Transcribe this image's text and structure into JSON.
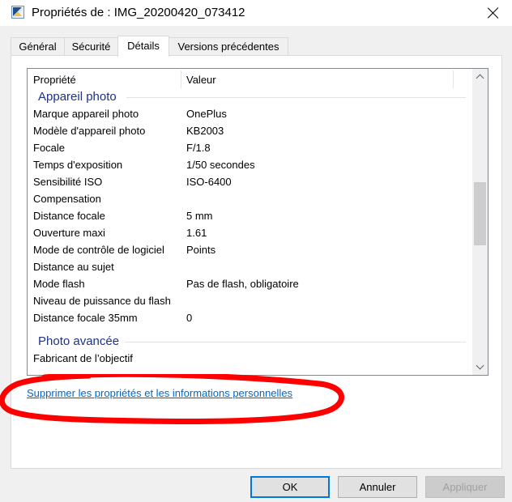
{
  "window": {
    "title": "Propriétés de : IMG_20200420_073412",
    "icon": "image-file-icon"
  },
  "tabs": [
    {
      "label": "Général",
      "active": false
    },
    {
      "label": "Sécurité",
      "active": false
    },
    {
      "label": "Détails",
      "active": true
    },
    {
      "label": "Versions précédentes",
      "active": false
    }
  ],
  "listview": {
    "headers": {
      "property": "Propriété",
      "value": "Valeur"
    },
    "groups": {
      "camera": "Appareil photo",
      "advanced": "Photo avancée"
    },
    "camera_rows": [
      {
        "property": "Marque appareil photo",
        "value": "OnePlus"
      },
      {
        "property": "Modèle d'appareil photo",
        "value": "KB2003"
      },
      {
        "property": "Focale",
        "value": "F/1.8"
      },
      {
        "property": "Temps d'exposition",
        "value": "1/50 secondes"
      },
      {
        "property": "Sensibilité ISO",
        "value": "ISO-6400"
      },
      {
        "property": "Compensation",
        "value": ""
      },
      {
        "property": "Distance focale",
        "value": "5 mm"
      },
      {
        "property": "Ouverture maxi",
        "value": "1.61"
      },
      {
        "property": "Mode de contrôle de logiciel",
        "value": "Points"
      },
      {
        "property": "Distance au sujet",
        "value": ""
      },
      {
        "property": "Mode flash",
        "value": "Pas de flash, obligatoire"
      },
      {
        "property": "Niveau de puissance du flash",
        "value": ""
      },
      {
        "property": "Distance focale 35mm",
        "value": "0"
      }
    ],
    "advanced_rows": [
      {
        "property": "Fabricant de l’objectif",
        "value": ""
      }
    ]
  },
  "link": {
    "remove_properties": "Supprimer les propriétés et les informations personnelles"
  },
  "buttons": {
    "ok": "OK",
    "cancel": "Annuler",
    "apply": "Appliquer"
  },
  "colors": {
    "group_header": "#1e3287",
    "link": "#0066cc",
    "annotation": "#ff0000",
    "default_button_border": "#0078d7"
  }
}
